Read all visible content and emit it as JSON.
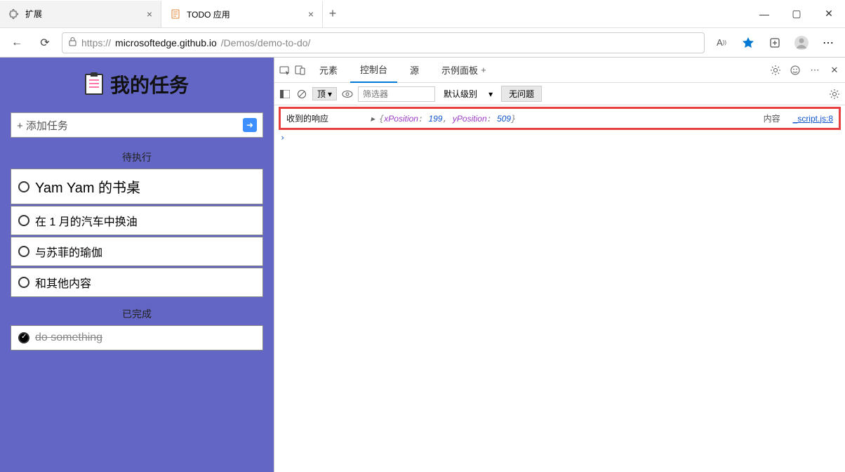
{
  "tabs": [
    {
      "title": "扩展",
      "icon": "puzzle"
    },
    {
      "title": "TODO 应用",
      "icon": "file"
    }
  ],
  "url": {
    "prefix": "https://",
    "host": "microsoftedge.github.io",
    "path": "/Demos/demo-to-do/"
  },
  "app": {
    "title": "我的任务",
    "add_placeholder": "+ 添加任务",
    "pending_header": "待执行",
    "pending": [
      "Yam Yam 的书桌",
      "在 1 月的汽车中换油",
      "与苏菲的瑜伽",
      "和其他内容"
    ],
    "completed_header": "已完成",
    "completed": [
      "do something"
    ]
  },
  "devtools": {
    "tabs": {
      "elements": "元素",
      "console": "控制台",
      "sources": "源",
      "sample": "示例面板"
    },
    "filter": {
      "top": "顶",
      "filter_placeholder": "筛选器",
      "level": "默认级别",
      "no_issues": "无问题"
    },
    "log": {
      "message": "收到的响应",
      "key1": "xPosition",
      "val1": "199",
      "key2": "yPosition",
      "val2": "509",
      "side": "内容",
      "source": "_script.js:8"
    }
  }
}
